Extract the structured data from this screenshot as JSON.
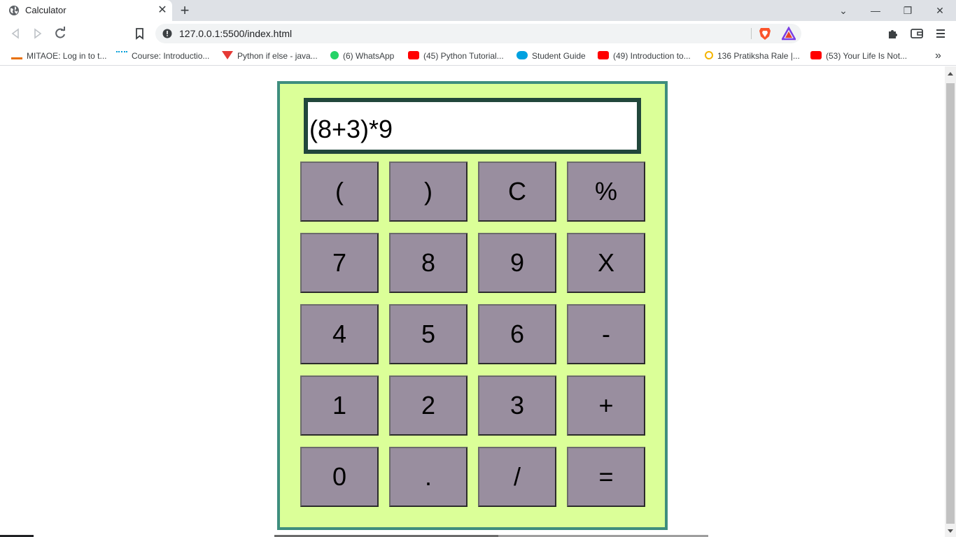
{
  "browser": {
    "tab_title": "Calculator",
    "tab_close": "✕",
    "new_tab": "+",
    "url": "127.0.0.1:5500/index.html",
    "window_buttons": {
      "dropdown": "⌄",
      "minimize": "—",
      "restore": "❐",
      "close": "✕"
    },
    "more_bookmarks": "»",
    "bookmarks": [
      {
        "label": "MITAOE: Log in to t...",
        "icon": "mitaoe-icon",
        "color": "#e8710a"
      },
      {
        "label": "Course: Introductio...",
        "icon": "cisco-icon",
        "color": "#049fd9"
      },
      {
        "label": "Python if else - java...",
        "icon": "v-logo-icon",
        "color": "#e53935"
      },
      {
        "label": "(6) WhatsApp",
        "icon": "whatsapp-icon",
        "color": "#25d366"
      },
      {
        "label": "(45) Python Tutorial...",
        "icon": "youtube-icon",
        "color": "#ff0000"
      },
      {
        "label": "Student Guide",
        "icon": "salesforce-icon",
        "color": "#00a1e0"
      },
      {
        "label": "(49) Introduction to...",
        "icon": "youtube-icon",
        "color": "#ff0000"
      },
      {
        "label": "136 Pratiksha Rale |...",
        "icon": "cloud-icon",
        "color": "#f4b400"
      },
      {
        "label": "(53) Your Life Is Not...",
        "icon": "youtube-icon",
        "color": "#ff0000"
      }
    ]
  },
  "calculator": {
    "display": "(8+3)*9",
    "keys": [
      [
        "(",
        ")",
        "C",
        "%"
      ],
      [
        "7",
        "8",
        "9",
        "X"
      ],
      [
        "4",
        "5",
        "6",
        "-"
      ],
      [
        "1",
        "2",
        "3",
        "+"
      ],
      [
        "0",
        ".",
        "/",
        "="
      ]
    ],
    "colors": {
      "body": "#dbff98",
      "border": "#3e8e7e",
      "display_border": "#21473b",
      "key": "#998e9f"
    }
  }
}
